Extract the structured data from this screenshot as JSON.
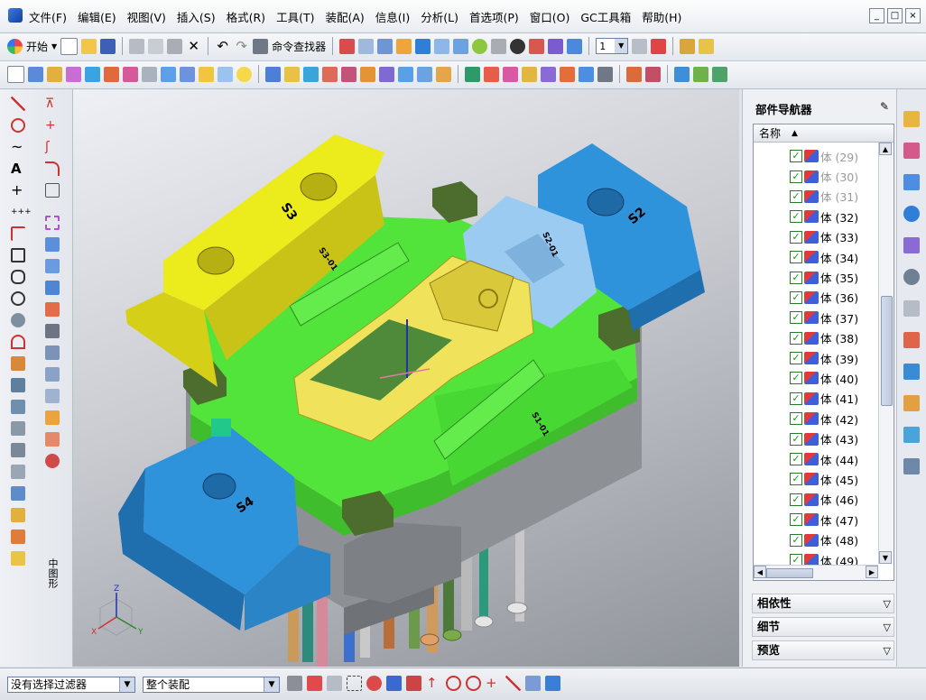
{
  "menubar": {
    "items": [
      "文件(F)",
      "编辑(E)",
      "视图(V)",
      "插入(S)",
      "格式(R)",
      "工具(T)",
      "装配(A)",
      "信息(I)",
      "分析(L)",
      "首选项(P)",
      "窗口(O)",
      "GC工具箱",
      "帮助(H)"
    ],
    "window_controls": [
      "_",
      "□",
      "×"
    ]
  },
  "toolbar": {
    "start_label": "开始",
    "command_finder_label": "命令查找器",
    "layer_value": "1"
  },
  "left_toolbar": {
    "vertical_label": "中图形"
  },
  "part_navigator": {
    "title": "部件导航器",
    "column_name": "名称",
    "rows": [
      {
        "label": "体 (29)",
        "dimmed": true
      },
      {
        "label": "体 (30)",
        "dimmed": true
      },
      {
        "label": "体 (31)",
        "dimmed": true
      },
      {
        "label": "体 (32)",
        "dimmed": false
      },
      {
        "label": "体 (33)",
        "dimmed": false
      },
      {
        "label": "体 (34)",
        "dimmed": false
      },
      {
        "label": "体 (35)",
        "dimmed": false
      },
      {
        "label": "体 (36)",
        "dimmed": false
      },
      {
        "label": "体 (37)",
        "dimmed": false
      },
      {
        "label": "体 (38)",
        "dimmed": false
      },
      {
        "label": "体 (39)",
        "dimmed": false
      },
      {
        "label": "体 (40)",
        "dimmed": false
      },
      {
        "label": "体 (41)",
        "dimmed": false
      },
      {
        "label": "体 (42)",
        "dimmed": false
      },
      {
        "label": "体 (43)",
        "dimmed": false
      },
      {
        "label": "体 (44)",
        "dimmed": false
      },
      {
        "label": "体 (45)",
        "dimmed": false
      },
      {
        "label": "体 (46)",
        "dimmed": false
      },
      {
        "label": "体 (47)",
        "dimmed": false
      },
      {
        "label": "体 (48)",
        "dimmed": false
      },
      {
        "label": "体 (49)",
        "dimmed": false
      }
    ],
    "sections": [
      "相依性",
      "细节",
      "预览"
    ]
  },
  "model_labels": {
    "s3": "S3",
    "s2": "S2",
    "s4": "S4",
    "s3_01": "S3-01",
    "s2_01": "S2-01",
    "s1_01": "S1-01",
    "axis_z": "Z",
    "axis_y": "Y",
    "axis_x": "X"
  },
  "statusbar": {
    "filter_value": "没有选择过滤器",
    "scope_value": "整个装配"
  },
  "colors": {
    "yellow_slide": "#ecec1c",
    "blue_slide": "#2f93dc",
    "light_blue_slide": "#9ccbf2",
    "green_plate": "#52e43a",
    "gray_base": "#8d9094",
    "olive_block": "#4c6d2e"
  }
}
